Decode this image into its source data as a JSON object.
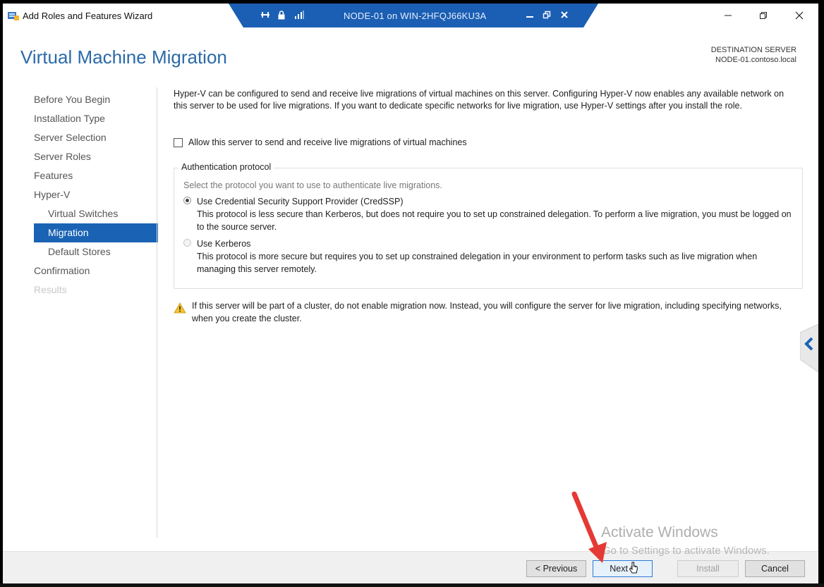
{
  "window": {
    "title": "Add Roles and Features Wizard"
  },
  "rdp": {
    "title": "NODE-01 on WIN-2HFQJ66KU3A"
  },
  "header": {
    "page_title": "Virtual Machine Migration",
    "destination_label": "DESTINATION SERVER",
    "destination_value": "NODE-01.contoso.local"
  },
  "nav": {
    "items": [
      {
        "label": "Before You Begin"
      },
      {
        "label": "Installation Type"
      },
      {
        "label": "Server Selection"
      },
      {
        "label": "Server Roles"
      },
      {
        "label": "Features"
      },
      {
        "label": "Hyper-V"
      },
      {
        "label": "Virtual Switches"
      },
      {
        "label": "Migration"
      },
      {
        "label": "Default Stores"
      },
      {
        "label": "Confirmation"
      },
      {
        "label": "Results"
      }
    ]
  },
  "content": {
    "intro": "Hyper-V can be configured to send and receive live migrations of virtual machines on this server. Configuring Hyper-V now enables any available network on this server to be used for live migrations. If you want to dedicate specific networks for live migration, use Hyper-V settings after you install the role.",
    "allow_label": "Allow this server to send and receive live migrations of virtual machines",
    "auth": {
      "legend": "Authentication protocol",
      "prompt": "Select the protocol you want to use to authenticate live migrations.",
      "options": [
        {
          "title": "Use Credential Security Support Provider (CredSSP)",
          "desc": "This protocol is less secure than Kerberos, but does not require you to set up constrained delegation. To perform a live migration, you must be logged on to the source server."
        },
        {
          "title": "Use Kerberos",
          "desc": "This protocol is more secure but requires you to set up constrained delegation in your environment to perform tasks such as live migration when managing this server remotely."
        }
      ]
    },
    "warning": "If this server will be part of a cluster, do not enable migration now. Instead, you will configure the server for live migration, including specifying networks, when you create the cluster."
  },
  "footer": {
    "previous": "< Previous",
    "next": "Next >",
    "install": "Install",
    "cancel": "Cancel"
  },
  "watermark": {
    "title": "Activate Windows",
    "subtitle": "Go to Settings to activate Windows."
  },
  "colors": {
    "accent": "#1a63b4",
    "title": "#2a6aa8",
    "rdp_bar": "#1b5fb4",
    "annotation_arrow": "#e53935"
  }
}
